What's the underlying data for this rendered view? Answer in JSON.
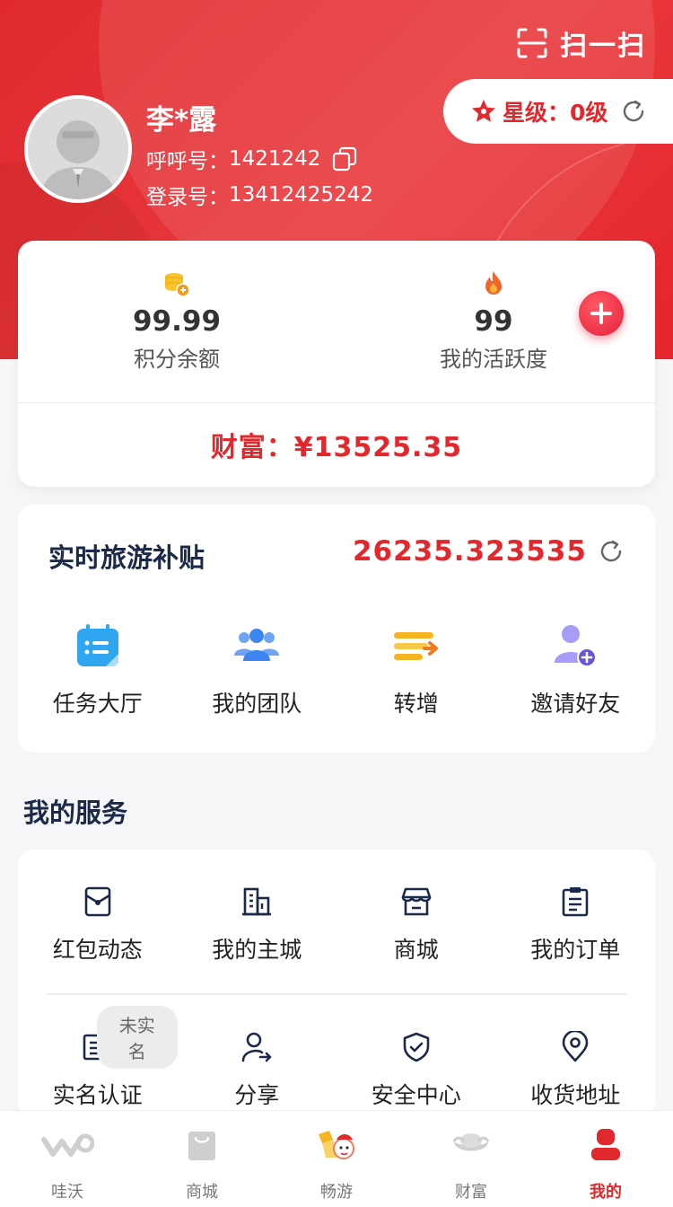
{
  "header": {
    "scan_label": "扫一扫",
    "user": {
      "name": "李*露",
      "huhu_label": "呼呼号：",
      "huhu_value": "1421242",
      "login_label": "登录号：",
      "login_value": "13412425242"
    },
    "star": {
      "label": "星级：",
      "value": "0级"
    }
  },
  "points_card": {
    "balance_value": "99.99",
    "balance_label": "积分余额",
    "activity_value": "99",
    "activity_label": "我的活跃度",
    "wealth_text": "财富：¥13525.35"
  },
  "subsidy_card": {
    "title": "实时旅游补贴",
    "value": "26235.323535",
    "quick_items": [
      {
        "label": "任务大厅"
      },
      {
        "label": "我的团队"
      },
      {
        "label": "转增"
      },
      {
        "label": "邀请好友"
      }
    ]
  },
  "services": {
    "title": "我的服务",
    "row1": [
      {
        "label": "红包动态"
      },
      {
        "label": "我的主城"
      },
      {
        "label": "商城"
      },
      {
        "label": "我的订单"
      }
    ],
    "row2": [
      {
        "label": "实名认证",
        "badge": "未实名"
      },
      {
        "label": "分享"
      },
      {
        "label": "安全中心"
      },
      {
        "label": "收货地址"
      }
    ]
  },
  "tabbar": {
    "tabs": [
      {
        "label": "哇沃"
      },
      {
        "label": "商城"
      },
      {
        "label": "畅游"
      },
      {
        "label": "财富"
      },
      {
        "label": "我的"
      }
    ],
    "active_index": 4
  },
  "colors": {
    "brand_red": "#e0282d",
    "navy_text": "#1c2a4a",
    "page_bg": "#f6f6f8"
  }
}
